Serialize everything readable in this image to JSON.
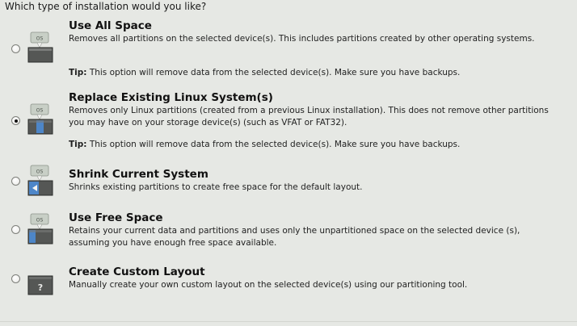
{
  "question": "Which type of installation would you like?",
  "options": [
    {
      "title": "Use All Space",
      "description": "Removes all partitions on the selected device(s).  This includes partitions created by other operating systems.",
      "tip_label": "Tip:",
      "tip_text": " This option will remove data from the selected device(s).  Make sure you have backups.",
      "selected": false,
      "icon": "disk-os-all-icon"
    },
    {
      "title": "Replace Existing Linux System(s)",
      "description": "Removes only Linux partitions (created from a previous Linux installation).  This does not remove other partitions you may have on your storage device(s) (such as VFAT or FAT32).",
      "tip_label": "Tip:",
      "tip_text": " This option will remove data from the selected device(s).  Make sure you have backups.",
      "selected": true,
      "icon": "disk-os-replace-icon"
    },
    {
      "title": "Shrink Current System",
      "description": "Shrinks existing partitions to create free space for the default layout.",
      "selected": false,
      "icon": "disk-os-shrink-icon"
    },
    {
      "title": "Use Free Space",
      "description": "Retains your current data and partitions and uses only the unpartitioned space on the selected device (s), assuming you have enough free space available.",
      "selected": false,
      "icon": "disk-os-free-icon"
    },
    {
      "title": "Create Custom Layout",
      "description": "Manually create your own custom layout on the selected device(s) using our partitioning tool.",
      "selected": false,
      "icon": "disk-custom-icon"
    }
  ],
  "icon_badge_text": "OS",
  "custom_icon_glyph": "?",
  "colors": {
    "background": "#e6e8e4",
    "disk_dark": "#4a4c4a",
    "disk_blue": "#4d86c8",
    "os_badge": "#c8cfc6"
  }
}
